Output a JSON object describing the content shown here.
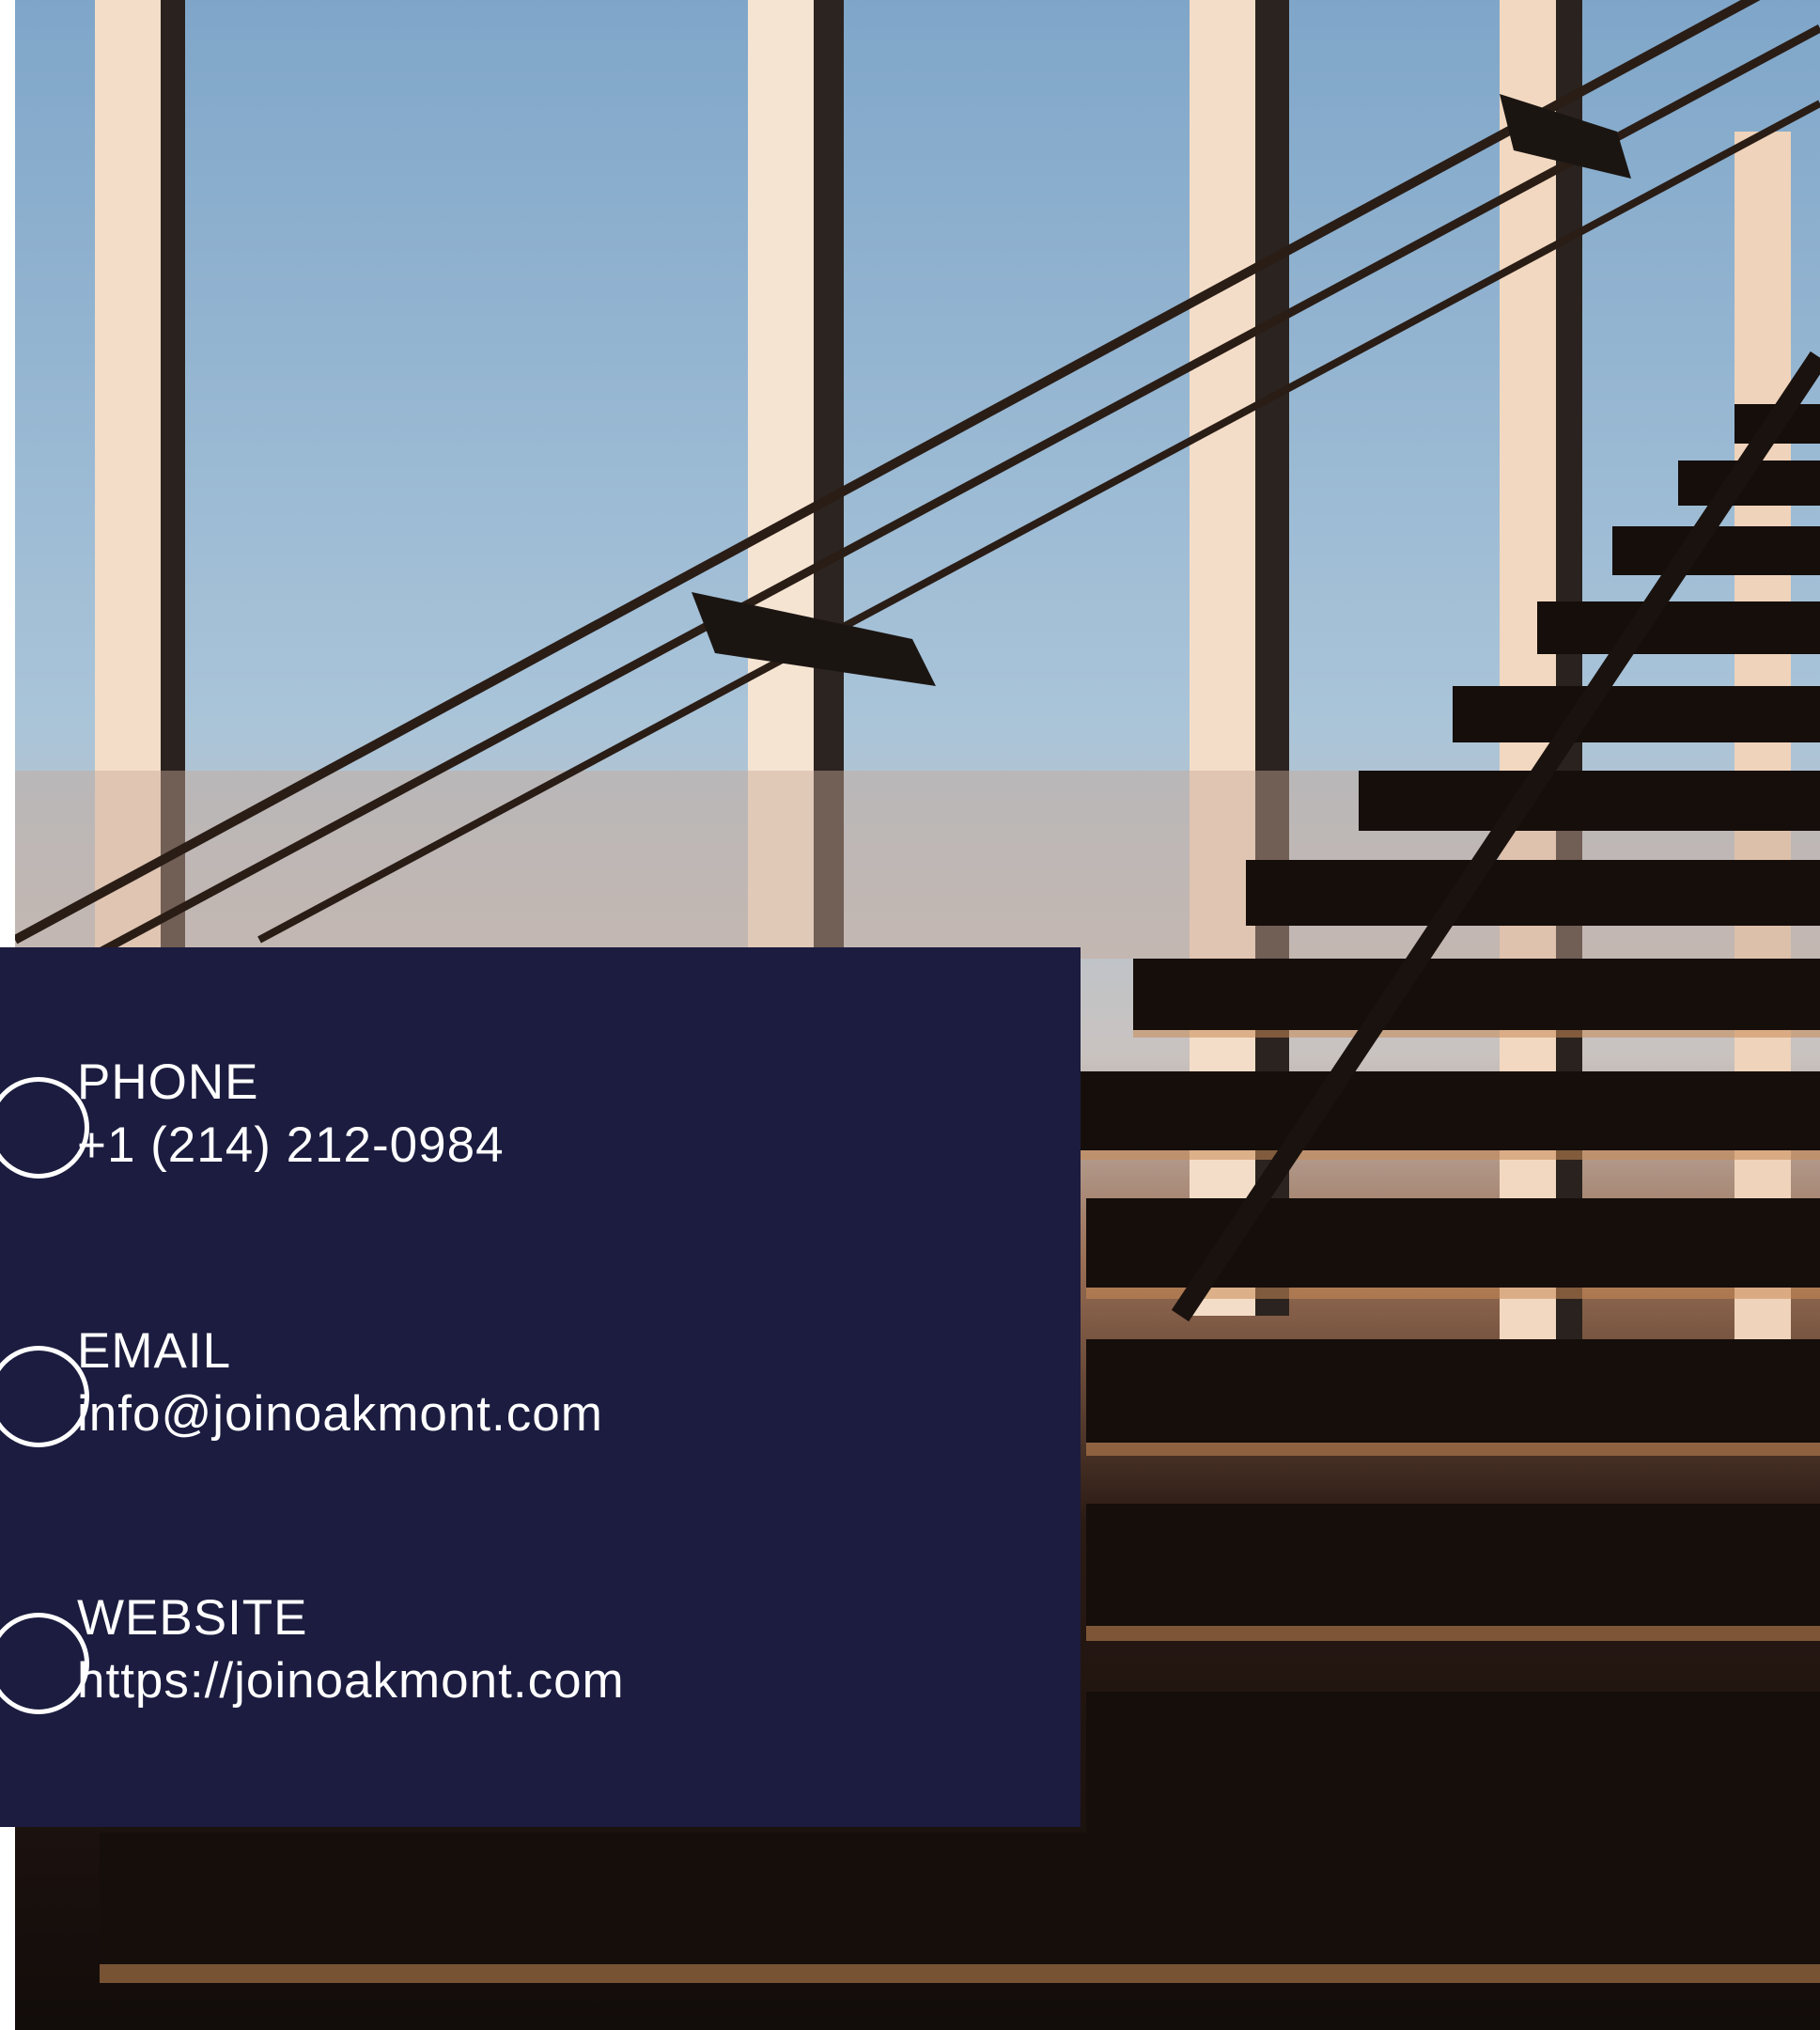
{
  "contact": {
    "phone": {
      "label": "PHONE",
      "value": "+1 (214) 212-0984",
      "icon": "phone-icon"
    },
    "email": {
      "label": "EMAIL",
      "value": "info@joinoakmont.com",
      "icon": "email-icon"
    },
    "website": {
      "label": "WEBSITE",
      "value": "https://joinoakmont.com",
      "icon": "globe-icon"
    }
  },
  "colors": {
    "card_background": "#1b1c3f",
    "text": "#ffffff"
  }
}
